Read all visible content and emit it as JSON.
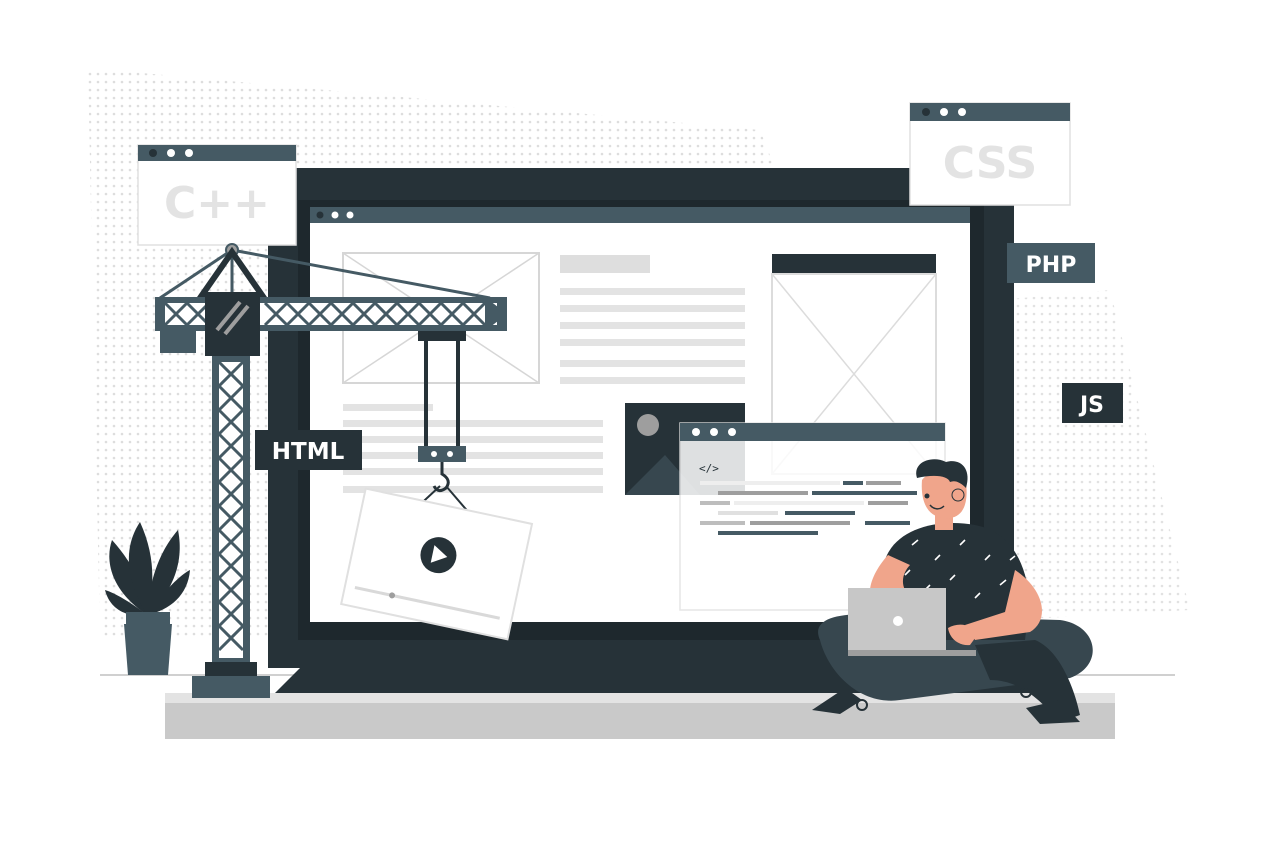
{
  "illustration": {
    "subject": "web-development-under-construction",
    "colors": {
      "dark": "#263238",
      "slate": "#455a64",
      "light_gray": "#e6e6e6",
      "mid_gray": "#c7c7c7",
      "panel_white": "#fafafa",
      "skin": "#f0a58b",
      "dots": "#d9d9d9"
    },
    "labels": {
      "cpp": "C++",
      "css": "CSS",
      "php": "PHP",
      "html": "HTML",
      "js": "JS",
      "code_tag": "</>"
    },
    "icons": [
      "crane-icon",
      "plant-icon",
      "play-icon",
      "laptop-icon",
      "person-icon",
      "image-placeholder-icon"
    ]
  }
}
